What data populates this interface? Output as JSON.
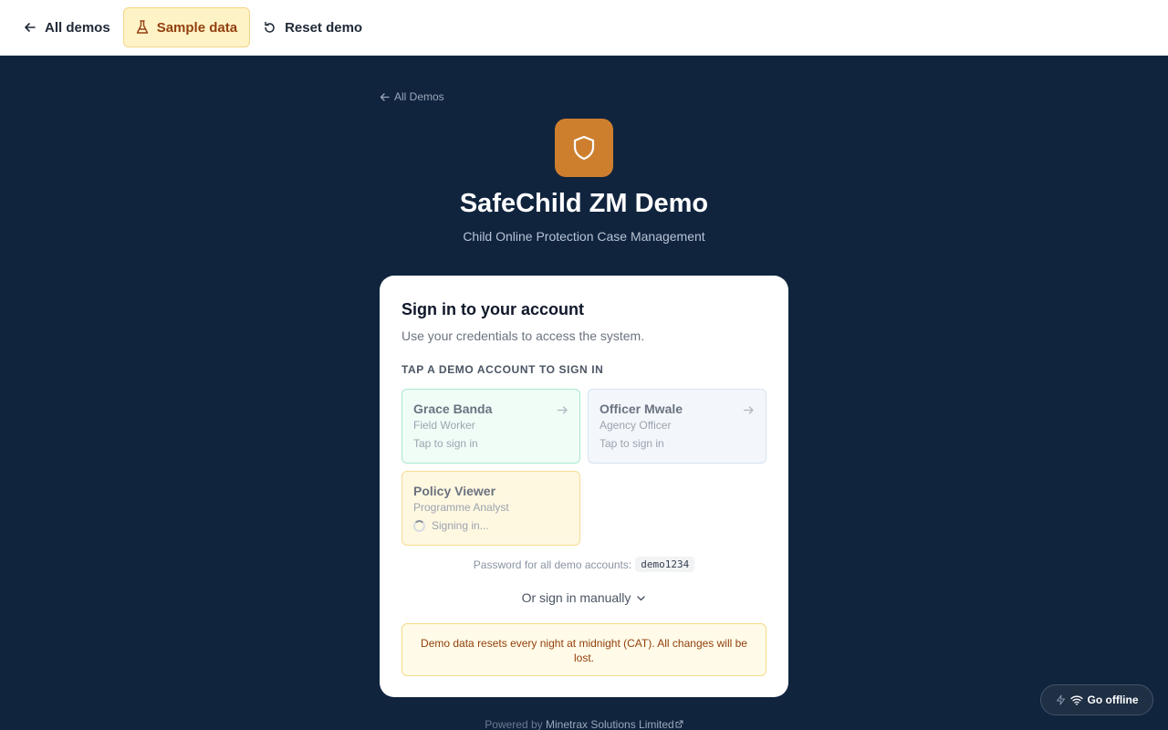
{
  "topbar": {
    "all_demos_label": "All demos",
    "sample_data_label": "Sample data",
    "reset_demo_label": "Reset demo"
  },
  "back_link_label": "All Demos",
  "app": {
    "title": "SafeChild ZM Demo",
    "subtitle": "Child Online Protection Case Management",
    "logo_color": "#cd7f2e"
  },
  "login": {
    "title": "Sign in to your account",
    "subtitle": "Use your credentials to access the system.",
    "demo_section_label": "TAP A DEMO ACCOUNT TO SIGN IN",
    "accounts": [
      {
        "name": "Grace Banda",
        "role": "Field Worker",
        "hint": "Tap to sign in"
      },
      {
        "name": "Officer Mwale",
        "role": "Agency Officer",
        "hint": "Tap to sign in"
      },
      {
        "name": "Policy Viewer",
        "role": "Programme Analyst",
        "hint": "Signing in..."
      }
    ],
    "password_note": "Password for all demo accounts:",
    "password_value": "demo1234",
    "manual_label": "Or sign in manually",
    "notice": "Demo data resets every night at midnight (CAT). All changes will be lost."
  },
  "offline_label": "Go offline",
  "footer": {
    "prefix": "Powered by",
    "company": "Minetrax Solutions Limited"
  }
}
